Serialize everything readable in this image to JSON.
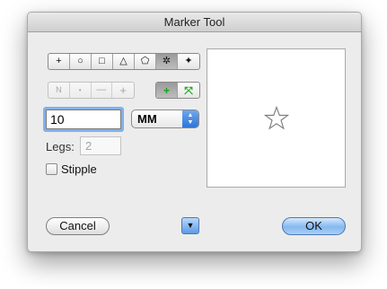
{
  "window": {
    "title": "Marker Tool"
  },
  "marker_bar": {
    "items": [
      {
        "glyph": "+",
        "icon": "plus-marker-icon",
        "selected": false
      },
      {
        "glyph": "○",
        "icon": "circle-marker-icon",
        "selected": false
      },
      {
        "glyph": "□",
        "icon": "square-marker-icon",
        "selected": false
      },
      {
        "glyph": "△",
        "icon": "triangle-marker-icon",
        "selected": false
      },
      {
        "glyph": "⬠",
        "icon": "pentagon-marker-icon",
        "selected": false
      },
      {
        "glyph": "✲",
        "icon": "star-marker-icon",
        "selected": true
      },
      {
        "glyph": "✦",
        "icon": "spike-marker-icon",
        "selected": false
      }
    ]
  },
  "style_bar": {
    "items": [
      {
        "glyph": "N",
        "icon": "n-style-icon"
      },
      {
        "glyph": "•",
        "icon": "dot-style-icon"
      },
      {
        "glyph": "—",
        "icon": "dash-style-icon"
      },
      {
        "glyph": "+",
        "icon": "plus-style-icon"
      }
    ]
  },
  "color_bar": {
    "items": [
      {
        "glyph": "+",
        "icon": "green-plus-icon",
        "selected": true
      },
      {
        "glyph": "⤧",
        "icon": "green-expand-icon",
        "selected": false
      }
    ],
    "accent": "#17a317"
  },
  "size": {
    "value": "10",
    "units": "MM"
  },
  "legs": {
    "label": "Legs:",
    "value": "2"
  },
  "stipple": {
    "label": "Stipple",
    "checked": false
  },
  "buttons": {
    "cancel": "Cancel",
    "ok": "OK"
  }
}
